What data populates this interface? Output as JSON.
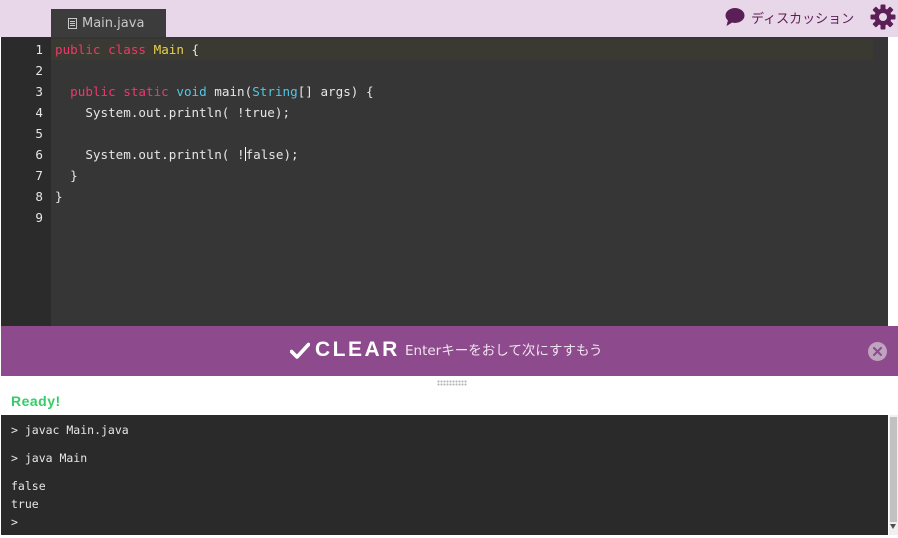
{
  "header": {
    "file_tab": "Main.java",
    "discussion_label": "ディスカッション"
  },
  "editor": {
    "line_numbers": [
      "1",
      "2",
      "3",
      "4",
      "5",
      "6",
      "7",
      "8",
      "9"
    ],
    "lines": [
      {
        "tokens": [
          {
            "t": "public",
            "c": "kw"
          },
          {
            "t": " "
          },
          {
            "t": "class",
            "c": "kw"
          },
          {
            "t": " "
          },
          {
            "t": "Main",
            "c": "cls"
          },
          {
            "t": " {"
          }
        ]
      },
      {
        "tokens": []
      },
      {
        "tokens": [
          {
            "t": "  "
          },
          {
            "t": "public",
            "c": "kw"
          },
          {
            "t": " "
          },
          {
            "t": "static",
            "c": "kw"
          },
          {
            "t": " "
          },
          {
            "t": "void",
            "c": "typ"
          },
          {
            "t": " main("
          },
          {
            "t": "String",
            "c": "typ"
          },
          {
            "t": "[] args) {"
          }
        ]
      },
      {
        "tokens": [
          {
            "t": "    System.out.println( !true);"
          }
        ]
      },
      {
        "tokens": []
      },
      {
        "tokens": [
          {
            "t": "    System.out.println( !"
          },
          {
            "caret": true
          },
          {
            "t": "false);"
          }
        ]
      },
      {
        "tokens": [
          {
            "t": "  }"
          }
        ]
      },
      {
        "tokens": [
          {
            "t": "}"
          }
        ]
      },
      {
        "tokens": []
      }
    ],
    "active_line": 0
  },
  "banner": {
    "title": "CLEAR",
    "subtitle": "Enterキーをおして次にすすもう"
  },
  "status": "Ready!",
  "console": {
    "lines": [
      "> javac Main.java",
      "> java Main",
      "false",
      "true",
      ">"
    ]
  },
  "colors": {
    "accent": "#8d4a8c",
    "header_bg": "#e8d7e8",
    "status_green": "#33cc66",
    "icon_purple": "#5b1e56"
  },
  "icons": {
    "tab": "file-icon",
    "discussion": "speech-bubble-icon",
    "settings": "gear-icon",
    "clear": "checkmark-icon",
    "close": "close-icon"
  }
}
